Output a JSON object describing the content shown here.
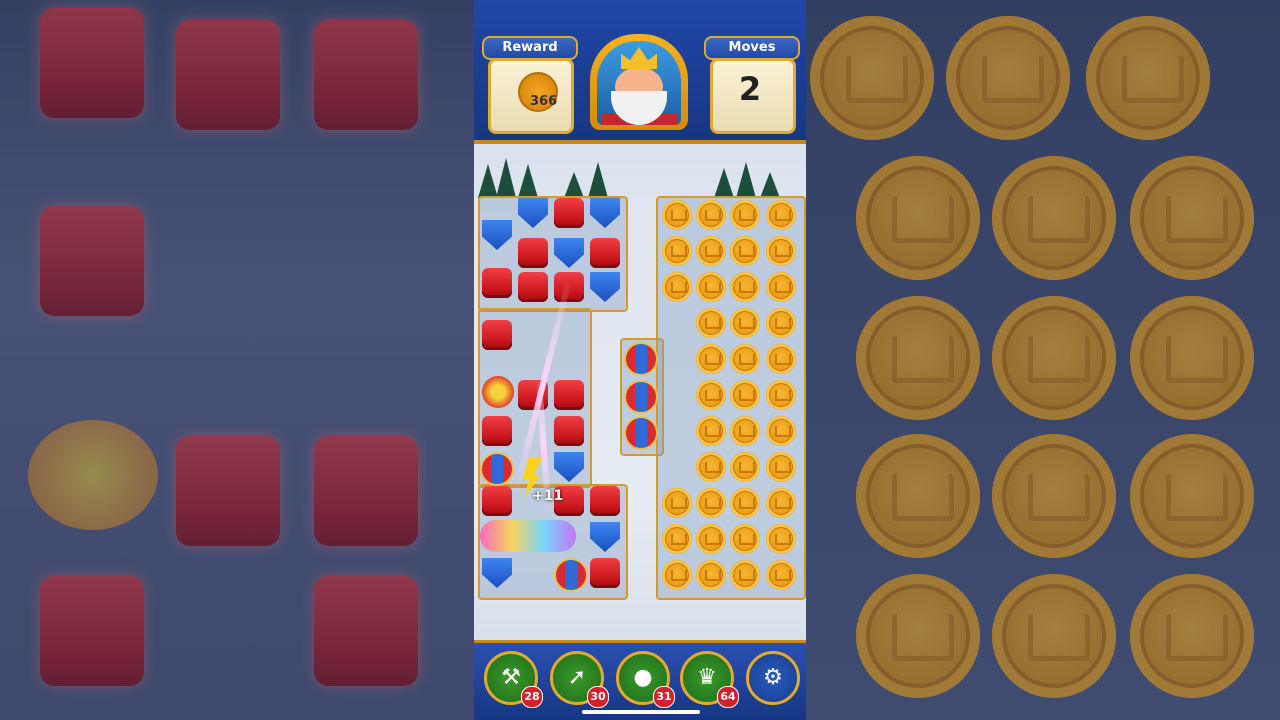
{
  "hud": {
    "reward_label": "Reward",
    "reward_value": "366",
    "moves_label": "Moves",
    "moves_value": "2"
  },
  "effect": {
    "bonus_text": "+11"
  },
  "boosters": [
    {
      "name": "hammer-booster",
      "icon": "hammer-icon",
      "count": "28"
    },
    {
      "name": "arrow-booster",
      "icon": "arrow-icon",
      "count": "30"
    },
    {
      "name": "cannon-booster",
      "icon": "cannon-icon",
      "count": "31"
    },
    {
      "name": "jester-booster",
      "icon": "jester-hat-icon",
      "count": "64"
    }
  ],
  "settings": {
    "icon": "gear-icon"
  },
  "colors": {
    "accent_gold": "#e0a834",
    "hud_blue": "#1c3f96",
    "block_red": "#d1171e",
    "shield_blue": "#2f6fe0",
    "coin_orange": "#eb9c12"
  }
}
